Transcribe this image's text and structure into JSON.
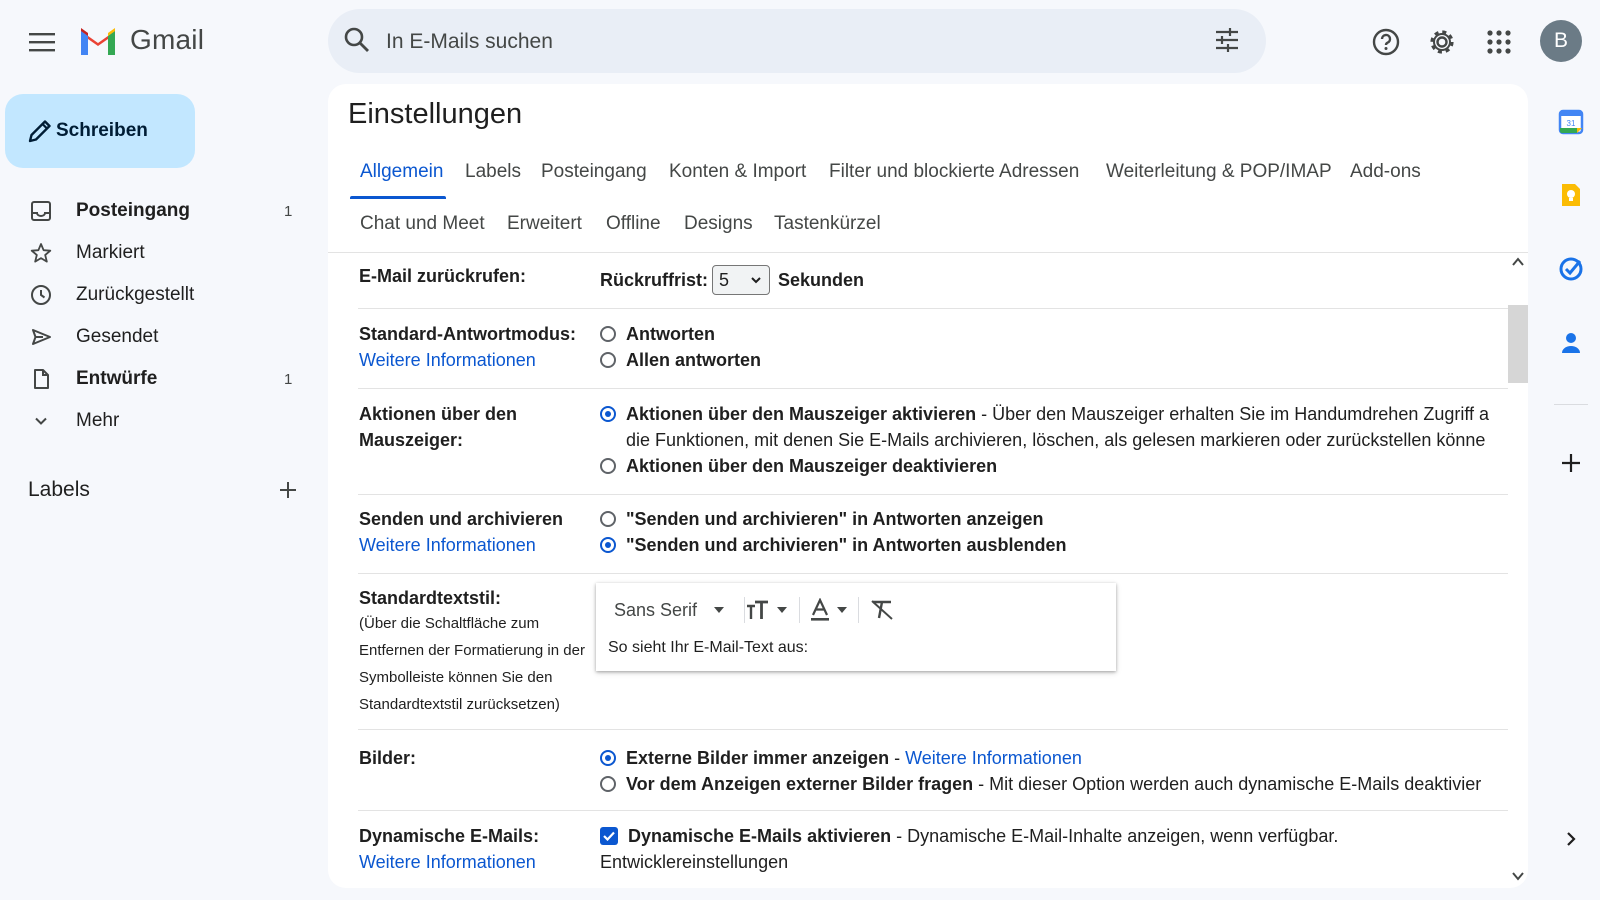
{
  "app": {
    "name": "Gmail"
  },
  "search": {
    "placeholder": "In E-Mails suchen"
  },
  "user": {
    "avatar_initial": "B"
  },
  "compose": {
    "label": "Schreiben"
  },
  "sidebar": {
    "items": [
      {
        "label": "Posteingang",
        "count": "1",
        "bold": true,
        "icon": "inbox-icon"
      },
      {
        "label": "Markiert",
        "count": "",
        "bold": false,
        "icon": "star-icon"
      },
      {
        "label": "Zurückgestellt",
        "count": "",
        "bold": false,
        "icon": "clock-icon"
      },
      {
        "label": "Gesendet",
        "count": "",
        "bold": false,
        "icon": "send-icon"
      },
      {
        "label": "Entwürfe",
        "count": "1",
        "bold": true,
        "icon": "draft-icon"
      },
      {
        "label": "Mehr",
        "count": "",
        "bold": false,
        "icon": "chevron-down-icon"
      }
    ],
    "labels_title": "Labels"
  },
  "settings": {
    "title": "Einstellungen",
    "tabs_row1": [
      "Allgemein",
      "Labels",
      "Posteingang",
      "Konten & Import",
      "Filter und blockierte Adressen",
      "Weiterleitung & POP/IMAP",
      "Add-ons"
    ],
    "tabs_row2": [
      "Chat und Meet",
      "Erweitert",
      "Offline",
      "Designs",
      "Tastenkürzel"
    ],
    "active_tab": "Allgemein",
    "recall": {
      "label": "E-Mail zurückrufen:",
      "prefix": "Rückruffrist:",
      "value": "5",
      "suffix": "Sekunden"
    },
    "reply_mode": {
      "label": "Standard-Antwortmodus:",
      "link": "Weitere Informationen",
      "options": [
        "Antworten",
        "Allen antworten"
      ],
      "selected": null
    },
    "hover_actions": {
      "label_line1": "Aktionen über den",
      "label_line2": "Mauszeiger:",
      "opt1_bold": "Aktionen über den Mauszeiger aktivieren",
      "opt1_desc_line1": " - Über den Mauszeiger erhalten Sie im Handumdrehen Zugriff a",
      "opt1_desc_line2": "die Funktionen, mit denen Sie E-Mails archivieren, löschen, als gelesen markieren oder zurückstellen könne",
      "opt2_bold": "Aktionen über den Mauszeiger deaktivieren",
      "selected": 0
    },
    "send_archive": {
      "label": "Senden und archivieren",
      "link": "Weitere Informationen",
      "options": [
        "\"Senden und archivieren\" in Antworten anzeigen",
        "\"Senden und archivieren\" in Antworten ausblenden"
      ],
      "selected": 1
    },
    "text_style": {
      "label": "Standardtextstil:",
      "note_lines": [
        "(Über die Schaltfläche zum",
        "Entfernen der Formatierung in der",
        "Symbolleiste können Sie den",
        "Standardtextstil zurücksetzen)"
      ],
      "font": "Sans Serif",
      "preview": "So sieht Ihr E-Mail-Text aus:"
    },
    "images": {
      "label": "Bilder:",
      "opt1_bold": "Externe Bilder immer anzeigen",
      "opt1_sep": " - ",
      "opt1_link": "Weitere Informationen",
      "opt2_bold": "Vor dem Anzeigen externer Bilder fragen",
      "opt2_desc": " - Mit dieser Option werden auch dynamische E-Mails deaktivier",
      "selected": 0
    },
    "dynamic_email": {
      "label": "Dynamische E-Mails:",
      "link": "Weitere Informationen",
      "checkbox_bold": "Dynamische E-Mails aktivieren",
      "checkbox_desc": " - Dynamische E-Mail-Inhalte anzeigen, wenn verfügbar.",
      "checked": true,
      "dev_link": "Entwicklereinstellungen"
    }
  },
  "colors": {
    "accent": "#0b57d0",
    "compose_bg": "#c2e7ff",
    "page_bg": "#f6f8fc"
  }
}
